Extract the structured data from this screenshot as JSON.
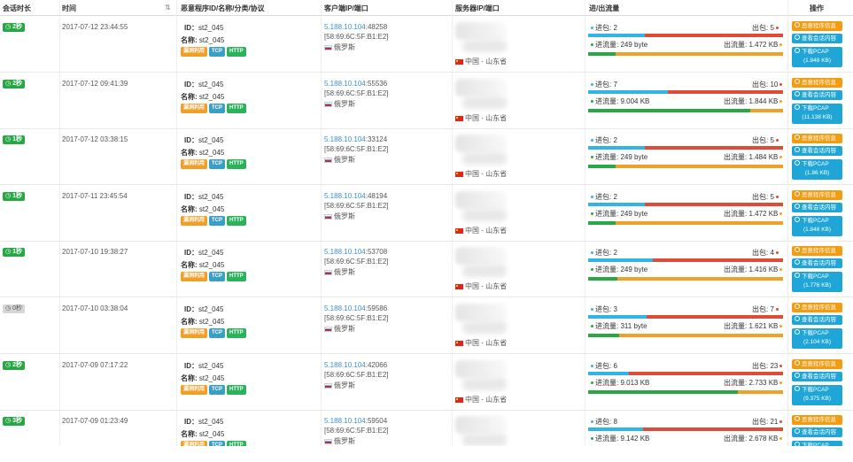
{
  "headers": {
    "duration": "会话时长",
    "time": "时间",
    "malware": "恶意程序ID/名称/分类/协议",
    "client": "客户端IP/端口",
    "server": "服务器IP/端口",
    "traffic": "进/出流量",
    "actions": "操作"
  },
  "colors": {
    "in_pkts": "#32b4e6",
    "out_pkts": "#dd4b39",
    "in_bytes": "#27a844",
    "out_bytes": "#f0a029"
  },
  "labels": {
    "id_prefix": "ID：",
    "name_prefix": "名称:",
    "pkt_in": "进包:",
    "pkt_out": "出包:",
    "byte_in": "进流量:",
    "byte_out": "出流量:",
    "btn_malware": "恶意程序信息",
    "btn_session": "查看会话内容",
    "btn_pcap": "下载PCAP"
  },
  "rows": [
    {
      "duration": "2秒",
      "dur_style": "green",
      "time": "2017-07-12 23:44:55",
      "id": "st2_045",
      "name": "st2_045",
      "tags": [
        "漏洞利用",
        "TCP",
        "HTTP"
      ],
      "client_ip": "5.188.10.104",
      "client_port": ":48258",
      "mac": "[58:69:6C:5F:B1:E2]",
      "client_country": "俄罗斯",
      "server_loc": "中国 - 山东省",
      "pkt_in": "2",
      "pkt_out": "5",
      "in_pkt_frac": 0.29,
      "byte_in": "249 byte",
      "byte_out": "1.472 KB",
      "in_byte_frac": 0.14,
      "pcap_size": "(1.848 KB)"
    },
    {
      "duration": "2秒",
      "dur_style": "green",
      "time": "2017-07-12 09:41:39",
      "id": "st2_045",
      "name": "st2_045",
      "tags": [
        "漏洞利用",
        "TCP",
        "HTTP"
      ],
      "client_ip": "5.188.10.104",
      "client_port": ":55536",
      "mac": "[58:69:6C:5F:B1:E2]",
      "client_country": "俄罗斯",
      "server_loc": "中国 - 山东省",
      "pkt_in": "7",
      "pkt_out": "10",
      "in_pkt_frac": 0.41,
      "byte_in": "9.004 KB",
      "byte_out": "1.844 KB",
      "in_byte_frac": 0.83,
      "pcap_size": "(11.138 KB)"
    },
    {
      "duration": "1秒",
      "dur_style": "green",
      "time": "2017-07-12 03:38:15",
      "id": "st2_045",
      "name": "st2_045",
      "tags": [
        "漏洞利用",
        "TCP",
        "HTTP"
      ],
      "client_ip": "5.188.10.104",
      "client_port": ":33124",
      "mac": "[58:69:6C:5F:B1:E2]",
      "client_country": "俄罗斯",
      "server_loc": "中国 - 山东省",
      "pkt_in": "2",
      "pkt_out": "5",
      "in_pkt_frac": 0.29,
      "byte_in": "249 byte",
      "byte_out": "1.484 KB",
      "in_byte_frac": 0.14,
      "pcap_size": "(1.86 KB)"
    },
    {
      "duration": "1秒",
      "dur_style": "green",
      "time": "2017-07-11 23:45:54",
      "id": "st2_045",
      "name": "st2_045",
      "tags": [
        "漏洞利用",
        "TCP",
        "HTTP"
      ],
      "client_ip": "5.188.10.104",
      "client_port": ":48194",
      "mac": "[58:69:6C:5F:B1:E2]",
      "client_country": "俄罗斯",
      "server_loc": "中国 - 山东省",
      "pkt_in": "2",
      "pkt_out": "5",
      "in_pkt_frac": 0.29,
      "byte_in": "249 byte",
      "byte_out": "1.472 KB",
      "in_byte_frac": 0.14,
      "pcap_size": "(1.848 KB)"
    },
    {
      "duration": "1秒",
      "dur_style": "green",
      "time": "2017-07-10 19:38:27",
      "id": "st2_045",
      "name": "st2_045",
      "tags": [
        "漏洞利用",
        "TCP",
        "HTTP"
      ],
      "client_ip": "5.188.10.104",
      "client_port": ":53708",
      "mac": "[58:69:6C:5F:B1:E2]",
      "client_country": "俄罗斯",
      "server_loc": "中国 - 山东省",
      "pkt_in": "2",
      "pkt_out": "4",
      "in_pkt_frac": 0.33,
      "byte_in": "249 byte",
      "byte_out": "1.416 KB",
      "in_byte_frac": 0.15,
      "pcap_size": "(1.776 KB)"
    },
    {
      "duration": "0秒",
      "dur_style": "gray",
      "time": "2017-07-10 03:38:04",
      "id": "st2_045",
      "name": "st2_045",
      "tags": [
        "漏洞利用",
        "TCP",
        "HTTP"
      ],
      "client_ip": "5.188.10.104",
      "client_port": ":59586",
      "mac": "[58:69:6C:5F:B1:E2]",
      "client_country": "俄罗斯",
      "server_loc": "中国 - 山东省",
      "pkt_in": "3",
      "pkt_out": "7",
      "in_pkt_frac": 0.3,
      "byte_in": "311 byte",
      "byte_out": "1.621 KB",
      "in_byte_frac": 0.16,
      "pcap_size": "(2.104 KB)"
    },
    {
      "duration": "2秒",
      "dur_style": "green",
      "time": "2017-07-09 07:17:22",
      "id": "st2_045",
      "name": "st2_045",
      "tags": [
        "漏洞利用",
        "TCP",
        "HTTP"
      ],
      "client_ip": "5.188.10.104",
      "client_port": ":42066",
      "mac": "[58:69:6C:5F:B1:E2]",
      "client_country": "俄罗斯",
      "server_loc": "中国 - 山东省",
      "pkt_in": "6",
      "pkt_out": "23",
      "in_pkt_frac": 0.21,
      "byte_in": "9.013 KB",
      "byte_out": "2.733 KB",
      "in_byte_frac": 0.77,
      "pcap_size": "(9.375 KB)"
    },
    {
      "duration": "3秒",
      "dur_style": "green",
      "time": "2017-07-09 01:23:49",
      "id": "st2_045",
      "name": "st2_045",
      "tags": [
        "漏洞利用",
        "TCP",
        "HTTP"
      ],
      "client_ip": "5.188.10.104",
      "client_port": ":59504",
      "mac": "[58:69:6C:5F:B1:E2]",
      "client_country": "俄罗斯",
      "server_loc": "中国 - 山东省",
      "pkt_in": "8",
      "pkt_out": "21",
      "in_pkt_frac": 0.28,
      "byte_in": "9.142 KB",
      "byte_out": "2.678 KB",
      "in_byte_frac": 0.77,
      "pcap_size": ""
    }
  ]
}
